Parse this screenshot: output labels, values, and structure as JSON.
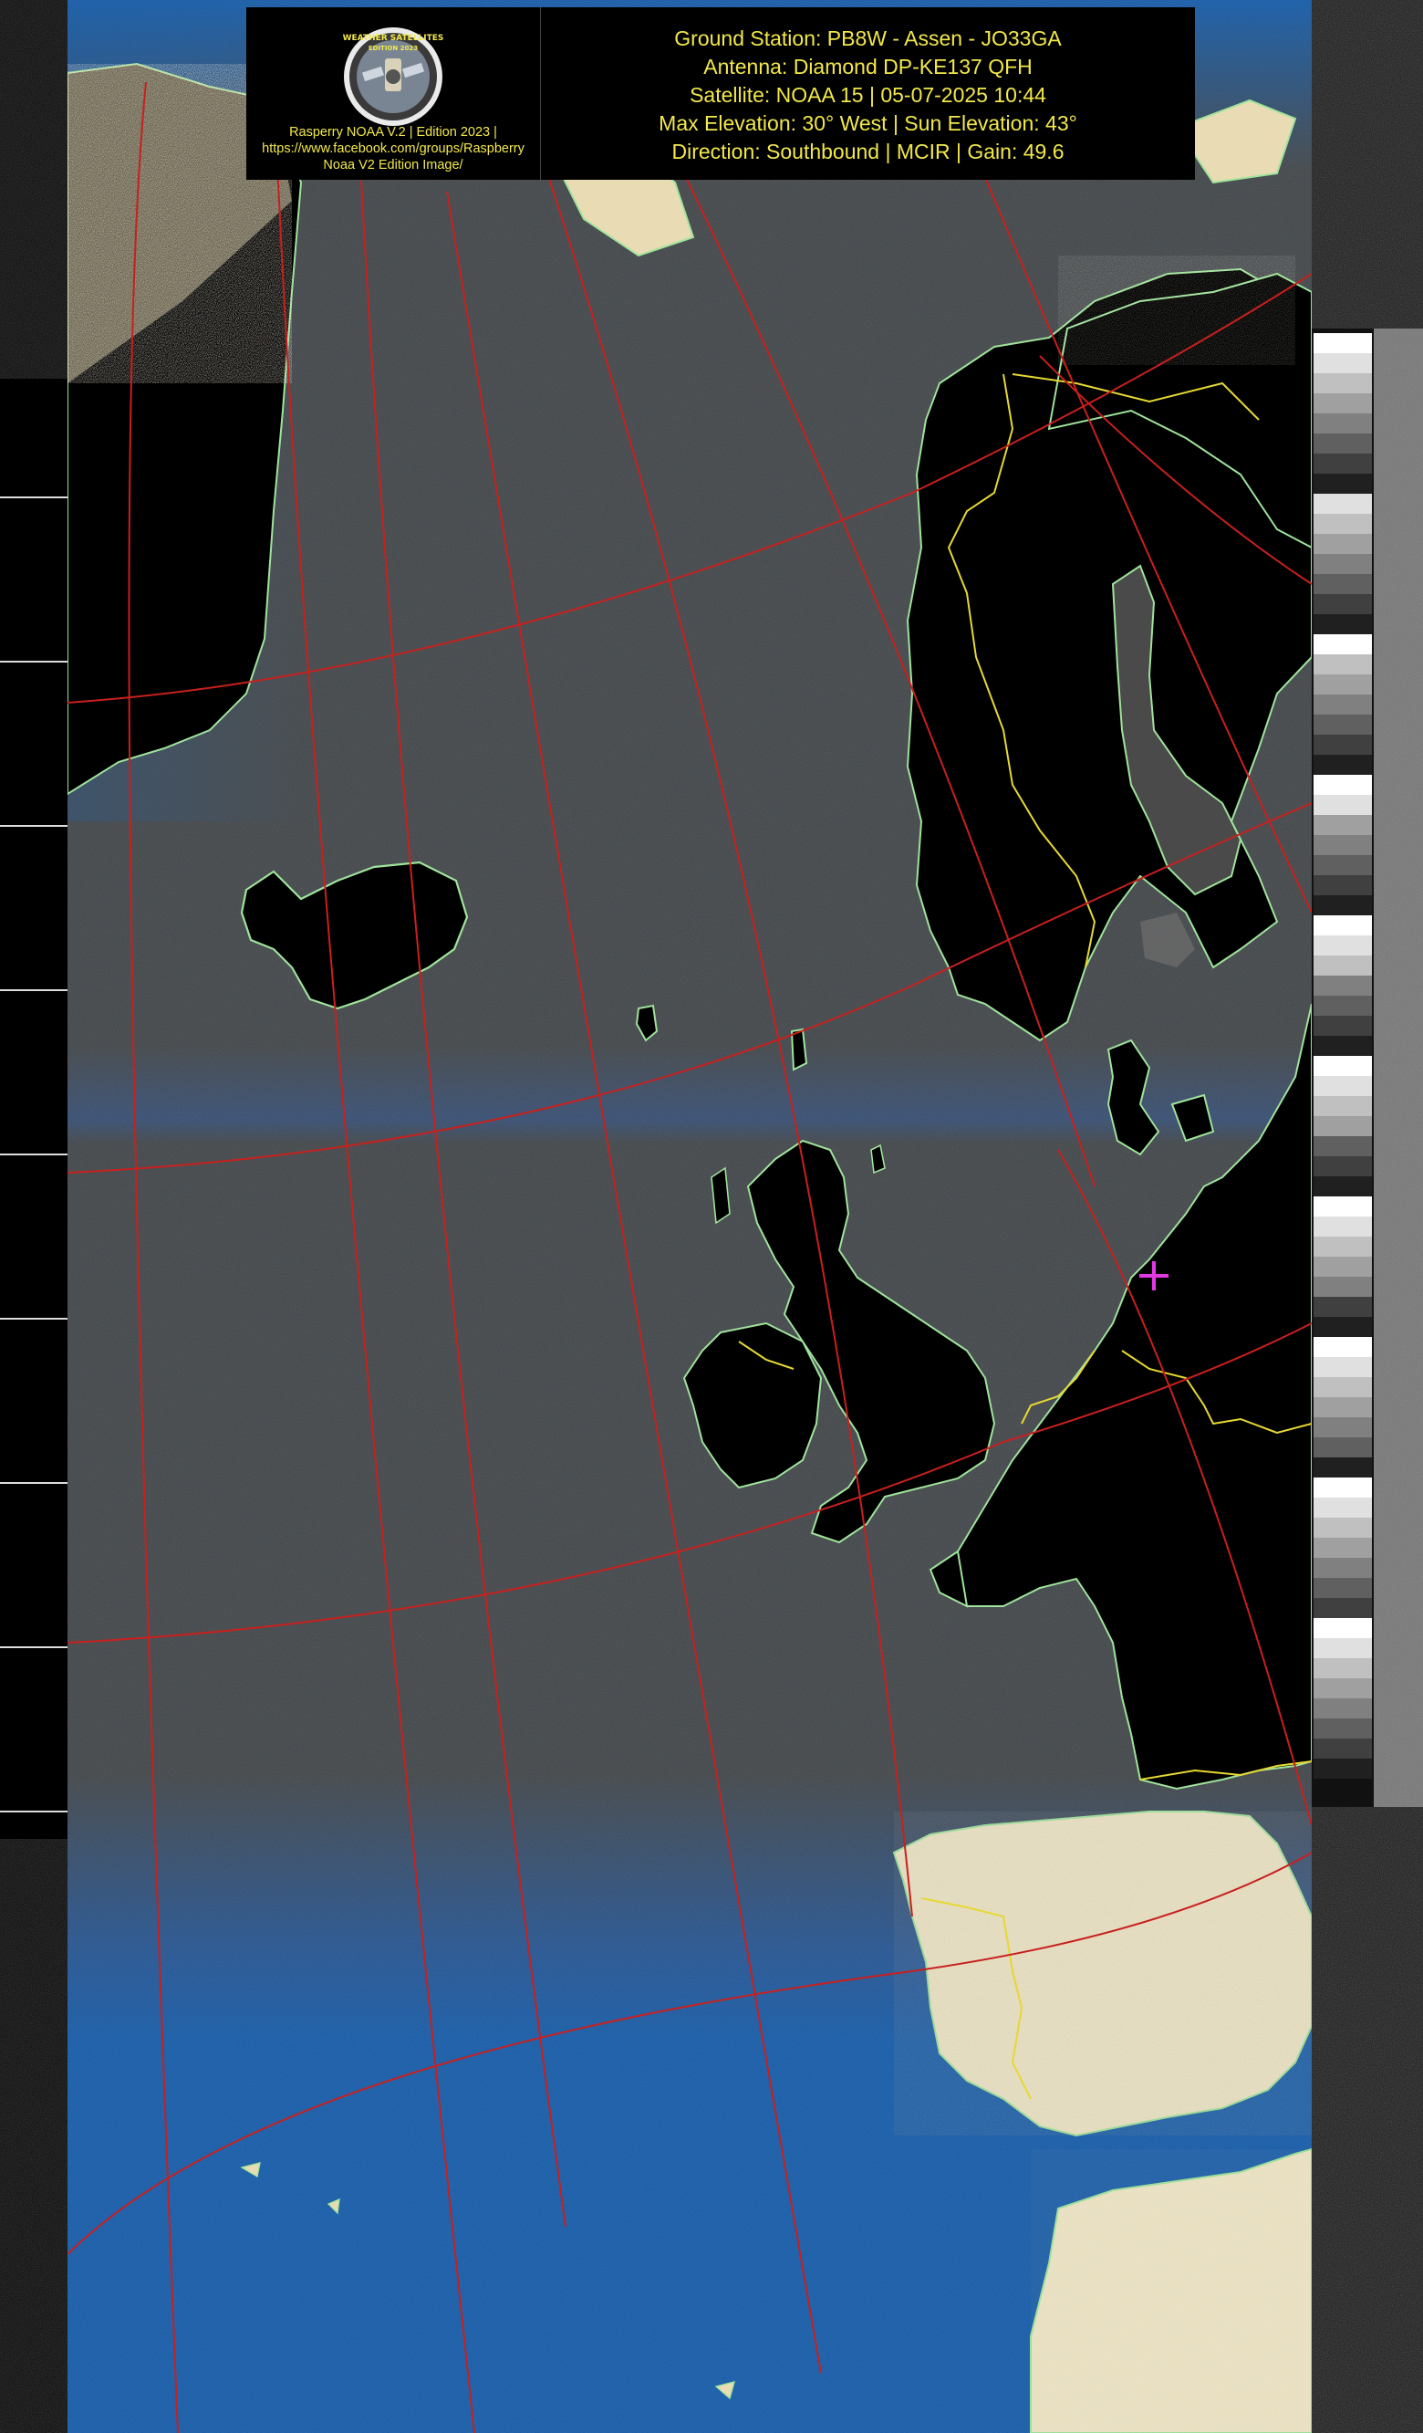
{
  "header": {
    "info_lines": [
      "Ground Station: PB8W - Assen - JO33GA",
      "Antenna: Diamond DP-KE137 QFH",
      "Satellite: NOAA 15 | 05-07-2025 10:44",
      "Max Elevation: 30° West | Sun Elevation: 43°",
      "Direction: Southbound | MCIR | Gain: 49.6"
    ],
    "credit_lines": [
      "Rasperry NOAA V.2 | Edition 2023 |",
      "https://www.facebook.com/groups/Raspberry",
      "Noaa V2 Edition Image/"
    ],
    "emblem_text": "WEATHER SATELLITES",
    "emblem_edition": "EDITION 2023"
  },
  "map": {
    "projection_grid": "latitude / longitude graticule",
    "colors": {
      "sea_warm": "#4a4a4a",
      "sea_cool": "#1e5fa8",
      "land": "#000000",
      "snow_desert": "#efe6c6",
      "coastline": "#9fe39b",
      "borders": "#e6d832",
      "graticule": "#c8201e",
      "ground_station_marker": "#e238e2"
    },
    "ground_station_marker": "ground-station-crosshair"
  }
}
